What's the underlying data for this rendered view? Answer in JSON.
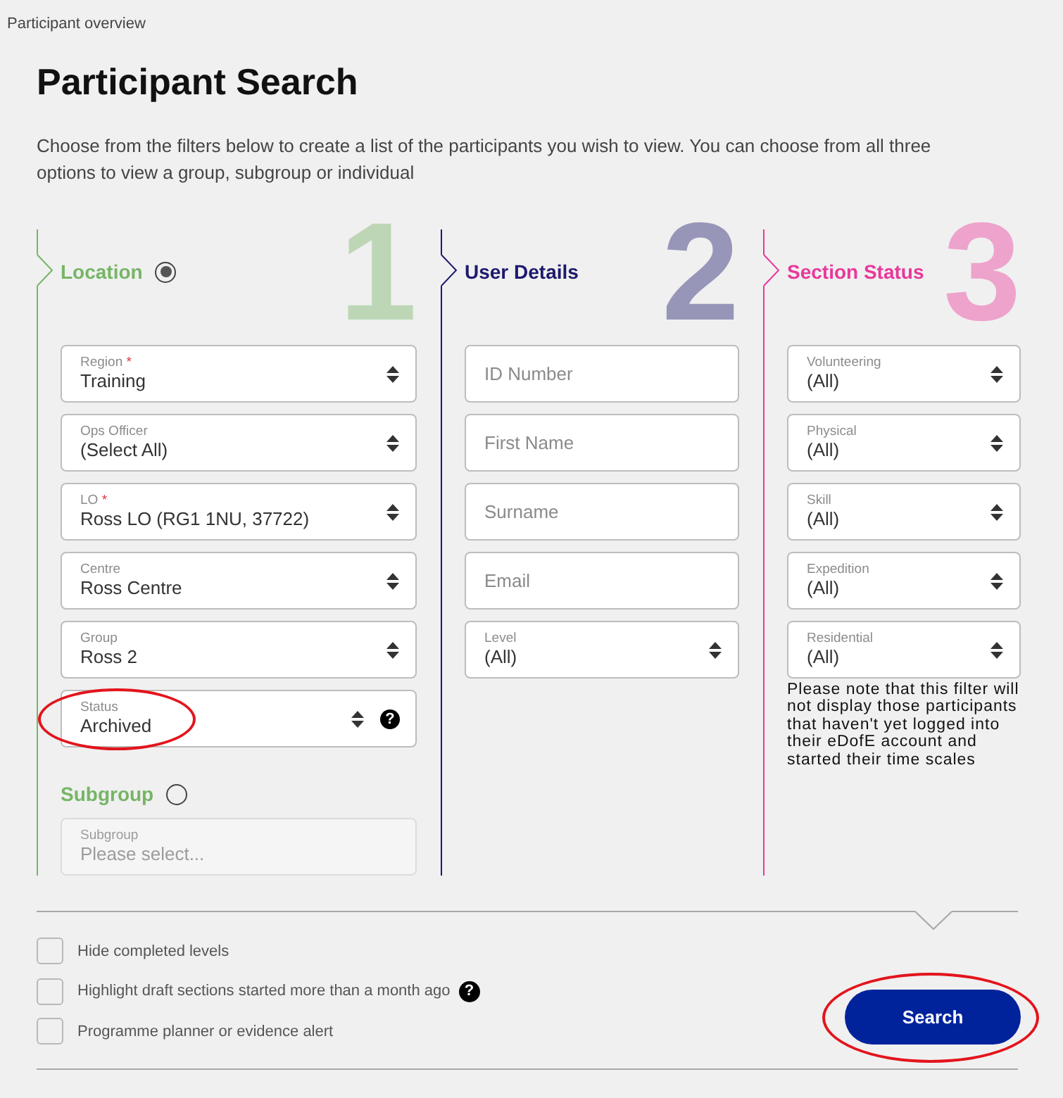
{
  "breadcrumb": "Participant overview",
  "title": "Participant Search",
  "description": "Choose from the filters below to create a list of the participants you wish to view. You can choose from all three options to view a group, subgroup or individual",
  "columns": [
    {
      "number": "1",
      "color": "#76b566",
      "groups": [
        {
          "title": "Location",
          "selected": true,
          "fields": [
            {
              "kind": "select",
              "label": "Region",
              "required_mark": "*",
              "value": "Training",
              "disabled": false,
              "circled": false
            },
            {
              "kind": "select",
              "label": "Ops Officer",
              "value": "(Select All)",
              "disabled": false,
              "circled": false
            },
            {
              "kind": "select",
              "label": "LO",
              "required_mark": "*",
              "value": "Ross LO (RG1 1NU, 37722)",
              "disabled": false,
              "circled": false
            },
            {
              "kind": "select",
              "label": "Centre",
              "value": "Ross Centre",
              "disabled": false,
              "circled": false
            },
            {
              "kind": "select",
              "label": "Group",
              "value": "Ross 2",
              "disabled": false,
              "circled": false
            },
            {
              "kind": "select",
              "label": "Status",
              "value": "Archived",
              "help_icon": "?",
              "disabled": false,
              "circled": true
            }
          ]
        },
        {
          "title": "Subgroup",
          "selected": false,
          "fields": [
            {
              "kind": "select",
              "label": "Subgroup",
              "placeholder": "Please select...",
              "disabled": true,
              "circled": false
            }
          ]
        }
      ]
    },
    {
      "number": "2",
      "color": "#1d1a6e",
      "groups": [
        {
          "title": "User Details",
          "fields": [
            {
              "kind": "input",
              "placeholder": "ID Number",
              "disabled": false,
              "circled": false
            },
            {
              "kind": "input",
              "placeholder": "First Name",
              "disabled": false,
              "circled": false
            },
            {
              "kind": "input",
              "placeholder": "Surname",
              "disabled": false,
              "circled": false
            },
            {
              "kind": "input",
              "placeholder": "Email",
              "disabled": false,
              "circled": false
            },
            {
              "kind": "select",
              "label": "Level",
              "value": "(All)",
              "disabled": false,
              "circled": false
            }
          ]
        }
      ]
    },
    {
      "number": "3",
      "color": "#e8389a",
      "groups": [
        {
          "title": "Section Status",
          "fields": [
            {
              "kind": "select",
              "label": "Volunteering",
              "value": "(All)",
              "disabled": false,
              "circled": false
            },
            {
              "kind": "select",
              "label": "Physical",
              "value": "(All)",
              "disabled": false,
              "circled": false
            },
            {
              "kind": "select",
              "label": "Skill",
              "value": "(All)",
              "disabled": false,
              "circled": false
            },
            {
              "kind": "select",
              "label": "Expedition",
              "value": "(All)",
              "disabled": false,
              "circled": false
            },
            {
              "kind": "select",
              "label": "Residential",
              "value": "(All)",
              "disabled": false,
              "circled": false
            }
          ]
        }
      ],
      "note": "Please note that this filter will not display those participants that haven't yet logged into their eDofE account and started their time scales"
    }
  ],
  "options": [
    {
      "label": "Hide completed levels",
      "checked": false
    },
    {
      "label": "Highlight draft sections started more than a month ago",
      "checked": false,
      "help_icon": "?"
    },
    {
      "label": "Programme planner or evidence alert",
      "checked": false
    }
  ],
  "search_button": {
    "label": "Search",
    "circled": true
  }
}
